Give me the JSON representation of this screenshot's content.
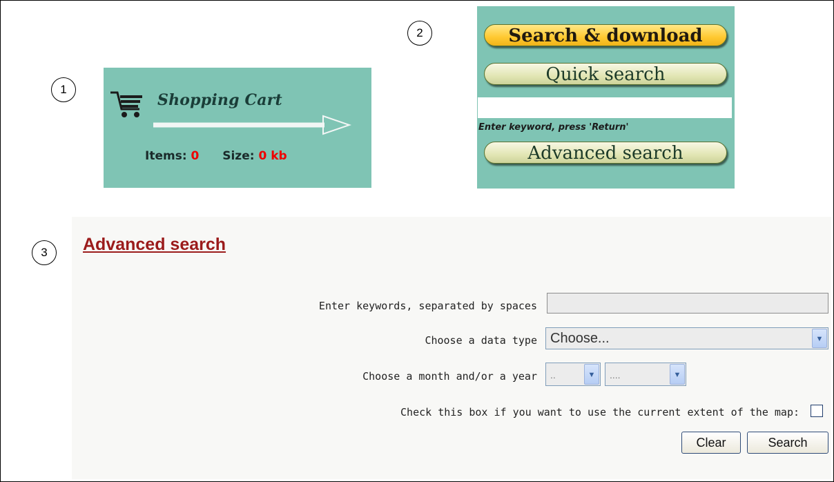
{
  "callouts": [
    "1",
    "2",
    "3"
  ],
  "cart": {
    "title": "Shopping Cart",
    "items_label": "Items:",
    "items_value": "0",
    "size_label": "Size:",
    "size_value": "0 kb",
    "icon": "shopping-cart-icon"
  },
  "search_download": {
    "active_label": "Search & download",
    "quick_label": "Quick search",
    "quick_value": "",
    "quick_hint": "Enter keyword, press 'Return'",
    "advanced_label": "Advanced search"
  },
  "advanced": {
    "title": "Advanced search",
    "keywords_label": "Enter keywords, separated by spaces",
    "keywords_value": "",
    "datatype_label": "Choose a data type",
    "datatype_value": "Choose...",
    "date_label": "Choose a month and/or a year",
    "month_value": "..",
    "year_value": "....",
    "extent_label": "Check this box if you want to use the current extent of the map:",
    "extent_checked": false,
    "clear_label": "Clear",
    "search_label": "Search"
  },
  "colors": {
    "panel_bg": "#7fc4b4",
    "accent_red": "#ee0000",
    "title_red": "#9b1b1b"
  }
}
